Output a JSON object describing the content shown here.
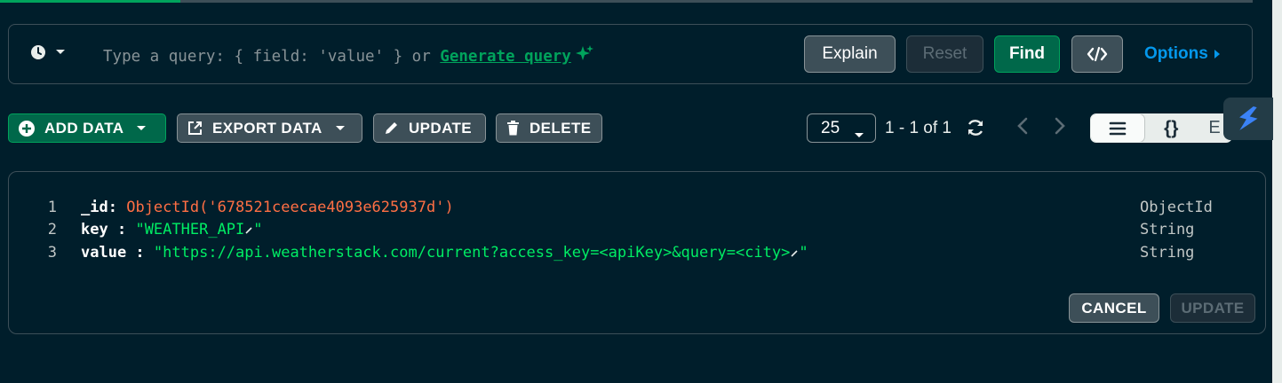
{
  "query_bar": {
    "placeholder_text": "Type a query: { field: 'value' } or ",
    "generate_link": "Generate query",
    "explain_label": "Explain",
    "reset_label": "Reset",
    "find_label": "Find",
    "options_label": "Options"
  },
  "toolbar": {
    "add_data_label": "ADD DATA",
    "export_data_label": "EXPORT DATA",
    "update_label": "UPDATE",
    "delete_label": "DELETE",
    "page_size": "25",
    "page_info": "1 - 1 of 1"
  },
  "document": {
    "rows": [
      {
        "line": "1",
        "key": "_id",
        "colon": ":",
        "value": "ObjectId('678521ceecae4093e625937d')",
        "type": "ObjectId"
      },
      {
        "line": "2",
        "key": "key",
        "colon": " :",
        "value": "\"WEATHER_API",
        "value_end": "\"",
        "type": "String"
      },
      {
        "line": "3",
        "key": "value",
        "colon": " :",
        "value": "\"https://api.weatherstack.com/current?access_key=<apiKey>&query=<city>",
        "value_end": "\"",
        "type": "String"
      }
    ],
    "cancel_label": "CANCEL",
    "update_label": "UPDATE"
  },
  "view_toggle": {
    "list_icon": "list-icon",
    "json_label": "{}",
    "table_label": "E"
  },
  "colors": {
    "background": "#001e2b",
    "accent_green": "#00a35c",
    "link_blue": "#0498ec",
    "objectid_orange": "#ff6f44",
    "string_green": "#00ed64"
  }
}
